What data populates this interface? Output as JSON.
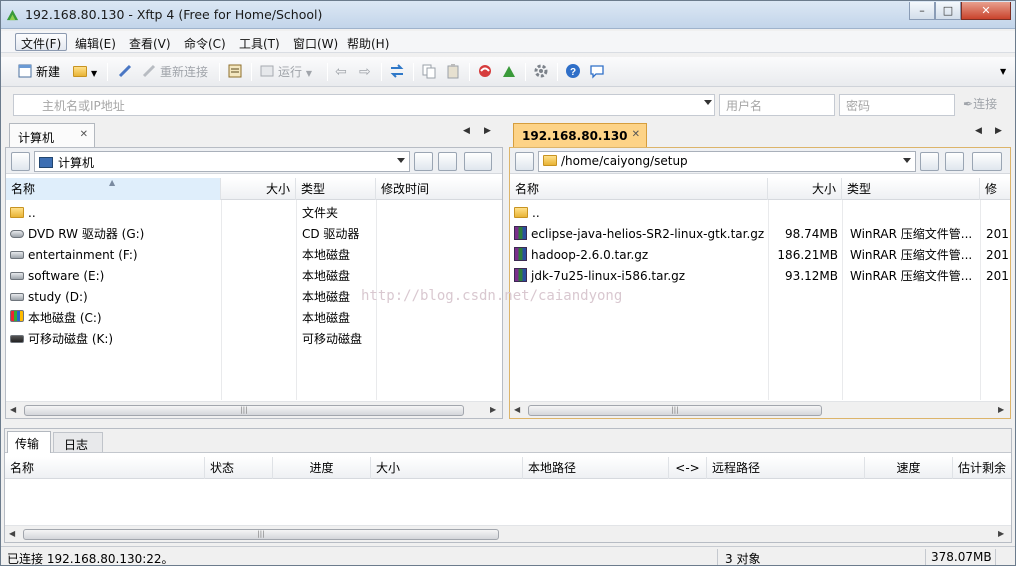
{
  "window": {
    "title": "192.168.80.130 - Xftp 4 (Free for Home/School)"
  },
  "menu": [
    "文件(F)",
    "编辑(E)",
    "查看(V)",
    "命令(C)",
    "工具(T)",
    "窗口(W)",
    "帮助(H)"
  ],
  "toolbar": {
    "new_label": "新建",
    "reconnect_label": "重新连接",
    "run_label": "运行"
  },
  "connect": {
    "host_placeholder": "主机名或IP地址",
    "user_placeholder": "用户名",
    "password_placeholder": "密码",
    "connect_label": "连接"
  },
  "local": {
    "tab": "计算机",
    "path": "计算机",
    "columns": [
      "名称",
      "大小",
      "类型",
      "修改时间"
    ],
    "rows": [
      {
        "name": "..",
        "size": "",
        "type": "文件夹",
        "icon": "folder-icon"
      },
      {
        "name": "DVD RW 驱动器 (G:)",
        "size": "",
        "type": "CD 驱动器",
        "icon": "dvd-drive-icon"
      },
      {
        "name": "entertainment (F:)",
        "size": "",
        "type": "本地磁盘",
        "icon": "drive-icon"
      },
      {
        "name": "software (E:)",
        "size": "",
        "type": "本地磁盘",
        "icon": "drive-icon"
      },
      {
        "name": "study (D:)",
        "size": "",
        "type": "本地磁盘",
        "icon": "drive-icon"
      },
      {
        "name": "本地磁盘 (C:)",
        "size": "",
        "type": "本地磁盘",
        "icon": "system-drive-icon"
      },
      {
        "name": "可移动磁盘 (K:)",
        "size": "",
        "type": "可移动磁盘",
        "icon": "removable-drive-icon"
      }
    ]
  },
  "remote": {
    "tab": "192.168.80.130",
    "path": "/home/caiyong/setup",
    "columns": [
      "名称",
      "大小",
      "类型",
      "修改"
    ],
    "rows": [
      {
        "name": "..",
        "size": "",
        "type": "",
        "date": "",
        "icon": "folder-icon"
      },
      {
        "name": "eclipse-java-helios-SR2-linux-gtk.tar.gz",
        "size": "98.74MB",
        "type": "WinRAR 压缩文件管...",
        "date": "201",
        "icon": "rar-icon"
      },
      {
        "name": "hadoop-2.6.0.tar.gz",
        "size": "186.21MB",
        "type": "WinRAR 压缩文件管...",
        "date": "201",
        "icon": "rar-icon"
      },
      {
        "name": "jdk-7u25-linux-i586.tar.gz",
        "size": "93.12MB",
        "type": "WinRAR 压缩文件管...",
        "date": "201",
        "icon": "rar-icon"
      }
    ]
  },
  "transfer": {
    "tabs": [
      "传输",
      "日志"
    ],
    "columns": [
      "名称",
      "状态",
      "进度",
      "大小",
      "本地路径",
      "<->",
      "远程路径",
      "速度",
      "估计剩余"
    ]
  },
  "watermark": "http://blog.csdn.net/caiandyong",
  "status": {
    "connection": "已连接 192.168.80.130:22。",
    "objects": "3 对象",
    "total_size": "378.07MB"
  },
  "colors": {
    "remote_tab": "#fdd387",
    "selection_header": "#dfeefb",
    "title_gradient": "#c3d5ea"
  }
}
